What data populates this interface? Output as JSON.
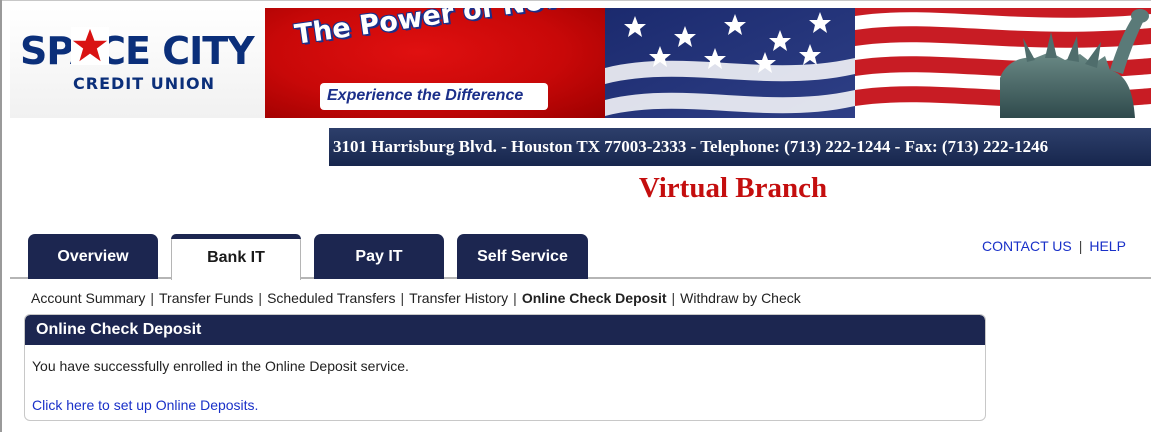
{
  "brand": {
    "logo_main": "SPACE CITY",
    "logo_sub": "CREDIT UNION",
    "tagline": "The Power of Now",
    "slogan": "Experience the Difference"
  },
  "contact": {
    "address_line": "3101 Harrisburg Blvd. - Houston  TX  77003-2333 - Telephone:  (713) 222-1244 - Fax:  (713) 222-1246"
  },
  "page_title": "Virtual Branch",
  "utility_links": {
    "contact": "CONTACT US",
    "help": "HELP"
  },
  "tabs": [
    {
      "label": "Overview",
      "active": false
    },
    {
      "label": "Bank IT",
      "active": true
    },
    {
      "label": "Pay IT",
      "active": false
    },
    {
      "label": "Self Service",
      "active": false
    }
  ],
  "subnav": [
    {
      "label": "Account Summary",
      "current": false
    },
    {
      "label": "Transfer Funds",
      "current": false
    },
    {
      "label": "Scheduled Transfers",
      "current": false
    },
    {
      "label": "Transfer History",
      "current": false
    },
    {
      "label": "Online Check Deposit",
      "current": true
    },
    {
      "label": "Withdraw by Check",
      "current": false
    }
  ],
  "panel": {
    "title": "Online Check Deposit",
    "message": "You have successfully enrolled in the Online Deposit service.",
    "link": "Click here to set up Online Deposits."
  },
  "colors": {
    "navy": "#1c2650",
    "banner_red": "#c80808",
    "title_red": "#c40e0e",
    "link_blue": "#1930c8"
  }
}
